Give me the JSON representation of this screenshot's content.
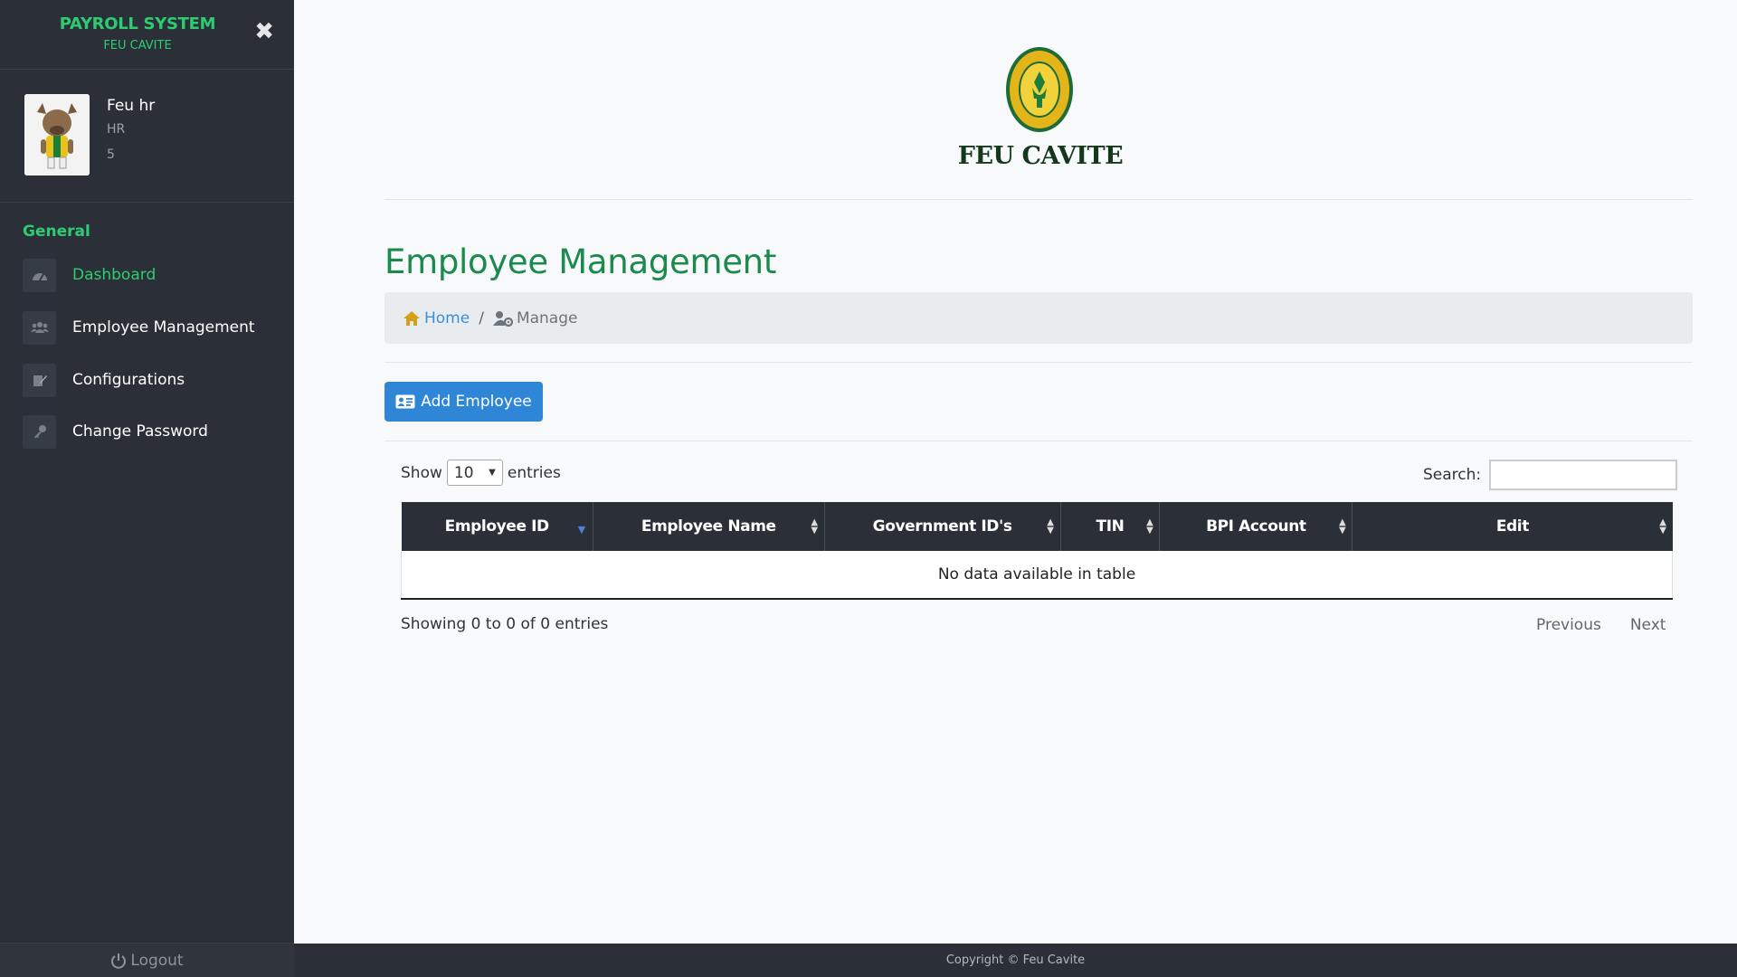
{
  "sidebar": {
    "brand_title": "PAYROLL SYSTEM",
    "brand_subtitle": "FEU CAVITE",
    "close_glyph": "✖",
    "profile": {
      "name": "Feu hr",
      "role": "HR",
      "id": "5"
    },
    "section_title": "General",
    "items": [
      {
        "label": "Dashboard",
        "icon": "tachometer-icon",
        "active": true
      },
      {
        "label": "Employee Management",
        "icon": "users-icon",
        "active": false
      },
      {
        "label": "Configurations",
        "icon": "edit-icon",
        "active": false
      },
      {
        "label": "Change Password",
        "icon": "key-icon",
        "active": false
      }
    ],
    "logout_label": "Logout"
  },
  "header": {
    "logo_text": "FEU CAVITE"
  },
  "main": {
    "title": "Employee Management",
    "breadcrumb": {
      "home": "Home",
      "separator": "/",
      "current": "Manage"
    },
    "add_button": "Add Employee",
    "show_label": "Show",
    "entries_value": "10",
    "entries_label": "entries",
    "search_label": "Search:",
    "search_value": "",
    "table": {
      "columns": [
        "Employee ID",
        "Employee Name",
        "Government ID's",
        "TIN",
        "BPI Account",
        "Edit"
      ],
      "empty_message": "No data available in table"
    },
    "info": "Showing 0 to 0 of 0 entries",
    "pager": {
      "previous": "Previous",
      "next": "Next"
    }
  },
  "footer": {
    "copyright": "Copyright © Feu Cavite"
  },
  "colors": {
    "sidebar_bg": "#2b3038",
    "accent_green": "#2ecc71",
    "title_green": "#1b8a4d",
    "button_blue": "#2f86d6",
    "link_blue": "#3b8fd6"
  }
}
